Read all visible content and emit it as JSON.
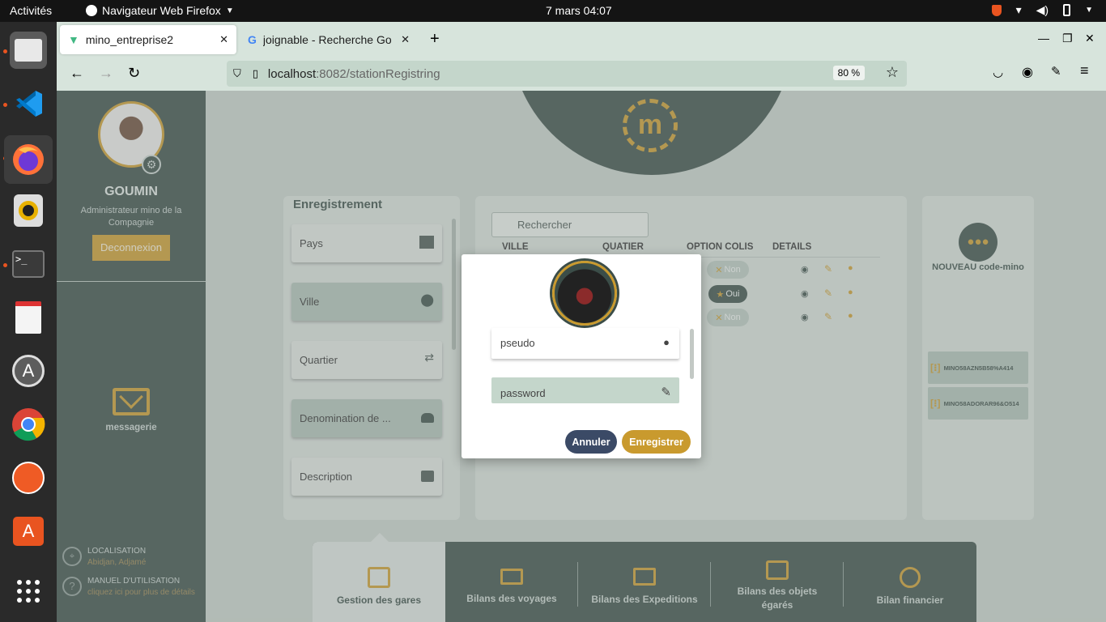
{
  "desktop": {
    "activities": "Activités",
    "app_name": "Navigateur Web Firefox",
    "clock": "7 mars  04:07"
  },
  "browser": {
    "tabs": [
      {
        "title": "mino_entreprise2",
        "active": true
      },
      {
        "title": "joignable - Recherche Go",
        "active": false
      }
    ],
    "url_host": "localhost",
    "url_path": ":8082/stationRegistring",
    "zoom": "80 %"
  },
  "sidebar": {
    "user_name": "GOUMIN",
    "user_role": "Administrateur mino de la Compagnie",
    "logout_label": "Deconnexion",
    "messaging_label": "messagerie",
    "location_title": "LOCALISATION",
    "location_value": "Abidjan, Adjamé",
    "manual_title": "MANUEL D'UTILISATION",
    "manual_hint": "cliquez ici pour plus de détails"
  },
  "registration": {
    "title": "Enregistrement",
    "fields": [
      "Pays",
      "Ville",
      "Quartier",
      "Denomination de ...",
      "Description"
    ]
  },
  "table": {
    "search_placeholder": "Rechercher",
    "headers": [
      "VILLE",
      "QUATIER",
      "OPTION COLIS",
      "DETAILS"
    ],
    "rows": [
      {
        "colis": "Non",
        "checked": false
      },
      {
        "colis": "Oui",
        "checked": true
      },
      {
        "colis": "Non",
        "checked": false
      }
    ]
  },
  "codes": {
    "new_label": "NOUVEAU code-mino",
    "items": [
      "MINO58AZN5B58%A414",
      "MINO58ADORAR96&O514"
    ]
  },
  "modal": {
    "pseudo_placeholder": "pseudo",
    "password_placeholder": "password",
    "cancel_label": "Annuler",
    "save_label": "Enregistrer"
  },
  "bottom_nav": [
    "Gestion des gares",
    "Bilans des voyages",
    "Bilans des Expeditions",
    "Bilans des objets égarés",
    "Bilan financier"
  ],
  "colors": {
    "accent": "#c99a2e",
    "dark": "#3b4d48",
    "navy": "#3b4a66"
  }
}
